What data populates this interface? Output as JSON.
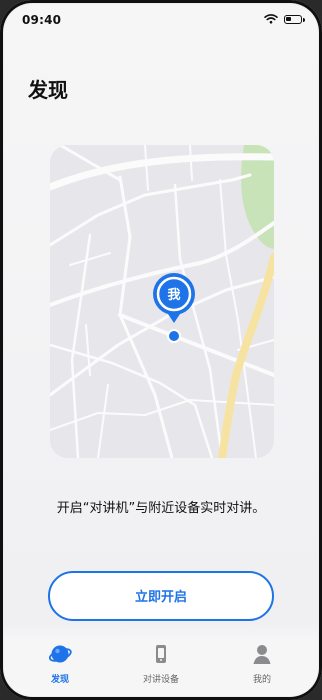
{
  "status": {
    "time": "09:40",
    "battery_percent": 40
  },
  "page": {
    "title": "发现"
  },
  "map": {
    "marker_label": "我"
  },
  "description": "开启“对讲机”与附近设备实时对讲。",
  "button": {
    "label": "立即开启"
  },
  "tabs": [
    {
      "label": "发现",
      "icon": "discover-icon",
      "active": true
    },
    {
      "label": "对讲设备",
      "icon": "device-icon",
      "active": false
    },
    {
      "label": "我的",
      "icon": "profile-icon",
      "active": false
    }
  ],
  "colors": {
    "accent": "#1e73e8",
    "road_yellow": "#f7e3a1",
    "park_green": "#c9e3b9"
  }
}
